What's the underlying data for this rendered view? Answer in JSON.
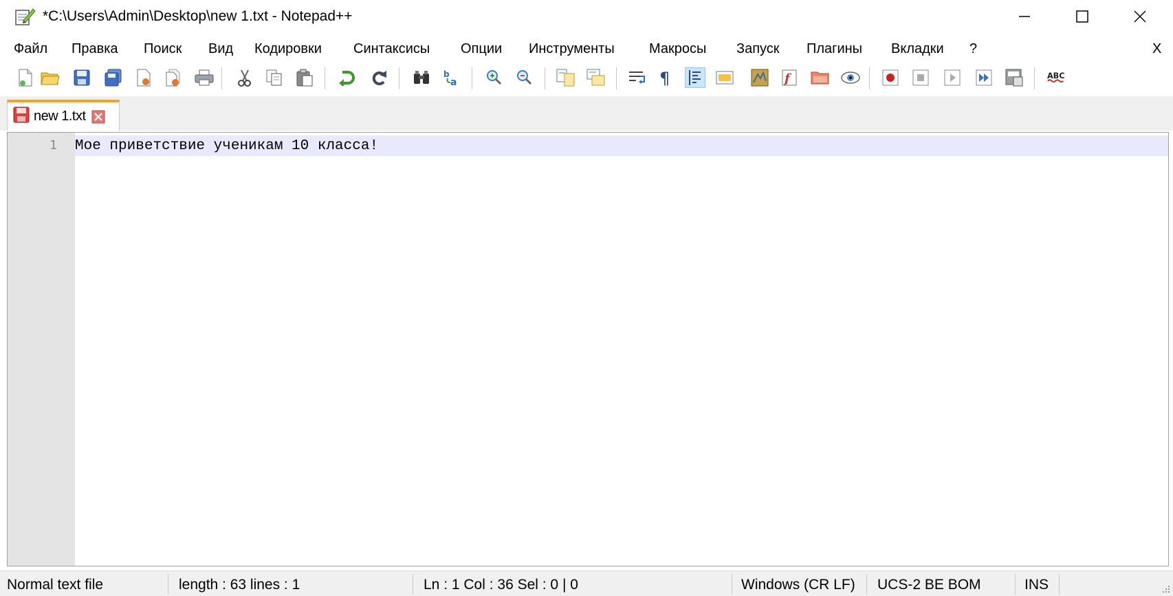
{
  "window": {
    "title": "*C:\\Users\\Admin\\Desktop\\new 1.txt - Notepad++"
  },
  "menu": {
    "items": [
      "Файл",
      "Правка",
      "Поиск",
      "Вид",
      "Кодировки",
      "Синтаксисы",
      "Опции",
      "Инструменты",
      "Макросы",
      "Запуск",
      "Плагины",
      "Вкладки",
      "?"
    ],
    "close_label": "X"
  },
  "toolbar": {
    "icons": [
      "new-file-icon",
      "open-file-icon",
      "save-icon",
      "save-all-icon",
      "close-icon",
      "close-all-icon",
      "print-icon",
      "cut-icon",
      "copy-icon",
      "paste-icon",
      "undo-icon",
      "redo-icon",
      "find-icon",
      "replace-icon",
      "zoom-in-icon",
      "zoom-out-icon",
      "sync-vertical-icon",
      "sync-horizontal-icon",
      "word-wrap-icon",
      "show-all-chars-icon",
      "indent-guide-icon",
      "user-language-icon",
      "document-map-icon",
      "function-list-icon",
      "folder-workspace-icon",
      "monitoring-icon",
      "record-macro-icon",
      "stop-macro-icon",
      "play-macro-icon",
      "run-macro-multiple-icon",
      "save-macro-icon",
      "spellcheck-icon"
    ]
  },
  "tab": {
    "label": "new 1.txt"
  },
  "editor": {
    "line_numbers": [
      "1"
    ],
    "lines": [
      "Мое приветствие ученикам 10 класса!"
    ]
  },
  "status": {
    "file_type": "Normal text file",
    "length": "length : 63    lines : 1",
    "position": "Ln : 1    Col : 36    Sel : 0 | 0",
    "eol": "Windows (CR LF)",
    "encoding": "UCS-2 BE BOM",
    "mode": "INS"
  },
  "colors": {
    "accent_tab": "#f7a31c",
    "current_line": "#e8e8ff",
    "gutter": "#e4e4e4"
  }
}
